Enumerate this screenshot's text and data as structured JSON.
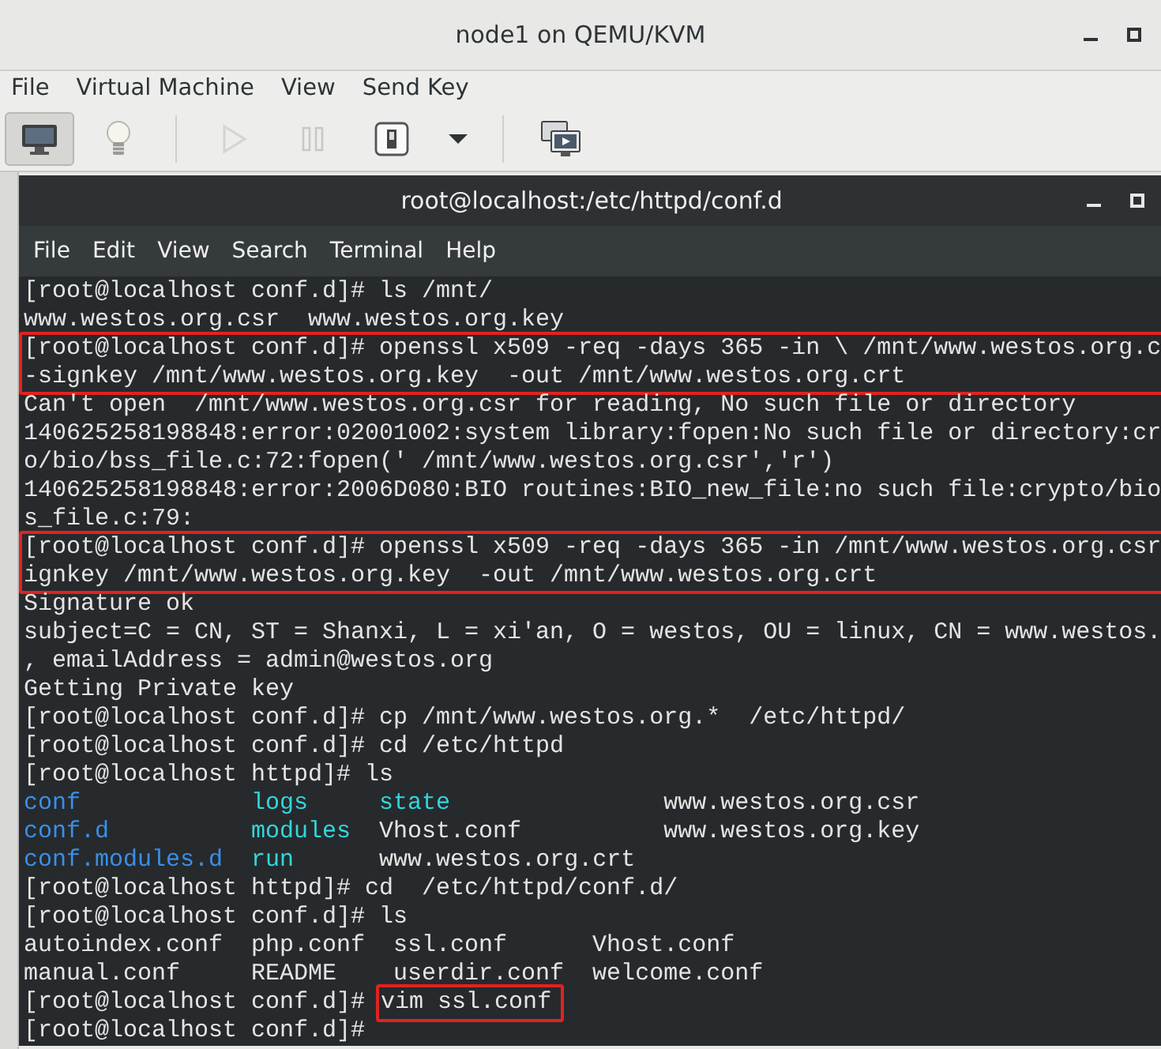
{
  "vm_window": {
    "title": "node1 on QEMU/KVM"
  },
  "menu": [
    "File",
    "Virtual Machine",
    "View",
    "Send Key"
  ],
  "toolbar": [
    {
      "kind": "console",
      "pressed": true,
      "disabled": false
    },
    {
      "kind": "details",
      "pressed": false,
      "disabled": false
    },
    {
      "kind": "separator"
    },
    {
      "kind": "run",
      "pressed": false,
      "disabled": true
    },
    {
      "kind": "pause",
      "pressed": false,
      "disabled": true
    },
    {
      "kind": "shutdown",
      "pressed": false,
      "disabled": false
    },
    {
      "kind": "dropdown",
      "pressed": false,
      "disabled": false
    },
    {
      "kind": "separator"
    },
    {
      "kind": "screens",
      "pressed": false,
      "disabled": false
    }
  ],
  "terminal": {
    "title": "root@localhost:/etc/httpd/conf.d",
    "menu": [
      "File",
      "Edit",
      "View",
      "Search",
      "Terminal",
      "Help"
    ],
    "lines": [
      {
        "boxed": false,
        "segments": [
          {
            "text": "[root@localhost conf.d]# ls /mnt/",
            "kind": "plain"
          }
        ]
      },
      {
        "boxed": false,
        "segments": [
          {
            "text": "www.westos.org.csr  www.westos.org.key",
            "kind": "plain"
          }
        ]
      },
      {
        "boxed": true,
        "segments": [
          {
            "text": "[root@localhost conf.d]# openssl x509 -req -days 365 -in \\ /mnt/www.westos.org.c",
            "kind": "plain"
          }
        ]
      },
      {
        "boxed": true,
        "segments": [
          {
            "text": "-signkey /mnt/www.westos.org.key  -out /mnt/www.westos.org.crt",
            "kind": "plain"
          }
        ]
      },
      {
        "boxed": false,
        "segments": [
          {
            "text": "Can't open  /mnt/www.westos.org.csr for reading, No such file or directory",
            "kind": "plain"
          }
        ]
      },
      {
        "boxed": false,
        "segments": [
          {
            "text": "140625258198848:error:02001002:system library:fopen:No such file or directory:cr",
            "kind": "plain"
          }
        ]
      },
      {
        "boxed": false,
        "segments": [
          {
            "text": "o/bio/bss_file.c:72:fopen(' /mnt/www.westos.org.csr','r')",
            "kind": "plain"
          }
        ]
      },
      {
        "boxed": false,
        "segments": [
          {
            "text": "140625258198848:error:2006D080:BIO routines:BIO_new_file:no such file:crypto/bio",
            "kind": "plain"
          }
        ]
      },
      {
        "boxed": false,
        "segments": [
          {
            "text": "s_file.c:79:",
            "kind": "plain"
          }
        ]
      },
      {
        "boxed": true,
        "segments": [
          {
            "text": "[root@localhost conf.d]# openssl x509 -req -days 365 -in /mnt/www.westos.org.csr",
            "kind": "plain"
          }
        ]
      },
      {
        "boxed": true,
        "segments": [
          {
            "text": "ignkey /mnt/www.westos.org.key  -out /mnt/www.westos.org.crt",
            "kind": "plain"
          }
        ]
      },
      {
        "boxed": false,
        "segments": [
          {
            "text": "Signature ok",
            "kind": "plain"
          }
        ]
      },
      {
        "boxed": false,
        "segments": [
          {
            "text": "subject=C = CN, ST = Shanxi, L = xi'an, O = westos, OU = linux, CN = www.westos.",
            "kind": "plain"
          }
        ]
      },
      {
        "boxed": false,
        "segments": [
          {
            "text": ", emailAddress = admin@westos.org",
            "kind": "plain"
          }
        ]
      },
      {
        "boxed": false,
        "segments": [
          {
            "text": "Getting Private key",
            "kind": "plain"
          }
        ]
      },
      {
        "boxed": false,
        "segments": [
          {
            "text": "[root@localhost conf.d]# cp /mnt/www.westos.org.*  /etc/httpd/",
            "kind": "plain"
          }
        ]
      },
      {
        "boxed": false,
        "segments": [
          {
            "text": "[root@localhost conf.d]# cd /etc/httpd",
            "kind": "plain"
          }
        ]
      },
      {
        "boxed": false,
        "segments": [
          {
            "text": "[root@localhost httpd]# ls",
            "kind": "plain"
          }
        ]
      },
      {
        "boxed": false,
        "segments": [
          {
            "text": "conf            ",
            "kind": "dir"
          },
          {
            "text": "logs     ",
            "kind": "link"
          },
          {
            "text": "state               ",
            "kind": "link"
          },
          {
            "text": "www.westos.org.csr",
            "kind": "plain"
          }
        ]
      },
      {
        "boxed": false,
        "segments": [
          {
            "text": "conf.d          ",
            "kind": "dir"
          },
          {
            "text": "modules  ",
            "kind": "link"
          },
          {
            "text": "Vhost.conf          ",
            "kind": "plain"
          },
          {
            "text": "www.westos.org.key",
            "kind": "plain"
          }
        ]
      },
      {
        "boxed": false,
        "segments": [
          {
            "text": "conf.modules.d  ",
            "kind": "dir"
          },
          {
            "text": "run      ",
            "kind": "link"
          },
          {
            "text": "www.westos.org.crt",
            "kind": "plain"
          }
        ]
      },
      {
        "boxed": false,
        "segments": [
          {
            "text": "[root@localhost httpd]# cd  /etc/httpd/conf.d/",
            "kind": "plain"
          }
        ]
      },
      {
        "boxed": false,
        "segments": [
          {
            "text": "[root@localhost conf.d]# ls",
            "kind": "plain"
          }
        ]
      },
      {
        "boxed": false,
        "segments": [
          {
            "text": "autoindex.conf  php.conf  ssl.conf      Vhost.conf",
            "kind": "plain"
          }
        ]
      },
      {
        "boxed": false,
        "segments": [
          {
            "text": "manual.conf     README    userdir.conf  welcome.conf",
            "kind": "plain"
          }
        ]
      },
      {
        "boxed": false,
        "segments": [
          {
            "text": "[root@localhost conf.d]# ",
            "kind": "plain"
          },
          {
            "text": "vim ssl.conf",
            "kind": "marked"
          }
        ]
      },
      {
        "boxed": false,
        "segments": [
          {
            "text": "[root@localhost conf.d]# ",
            "kind": "plain"
          }
        ]
      }
    ]
  }
}
